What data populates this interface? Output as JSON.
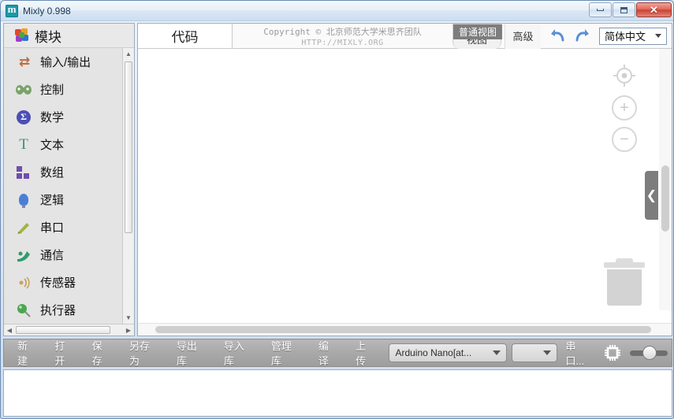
{
  "window": {
    "title": "Mixly 0.998",
    "app_icon": "mixly-app-icon",
    "controls": {
      "minimize": "minimize-icon",
      "maximize": "restore-icon",
      "close": "✕"
    }
  },
  "sidebar": {
    "header": {
      "label": "模块",
      "icon": "puzzle-icon"
    },
    "items": [
      {
        "label": "输入/输出",
        "icon": "input-output-icon",
        "glyph": "⇄"
      },
      {
        "label": "控制",
        "icon": "control-icon",
        "glyph": "🎮"
      },
      {
        "label": "数学",
        "icon": "math-icon",
        "glyph": "∑"
      },
      {
        "label": "文本",
        "icon": "text-icon",
        "glyph": "T"
      },
      {
        "label": "数组",
        "icon": "array-icon",
        "glyph": ""
      },
      {
        "label": "逻辑",
        "icon": "logic-icon",
        "glyph": ""
      },
      {
        "label": "串口",
        "icon": "serial-icon",
        "glyph": "✎"
      },
      {
        "label": "通信",
        "icon": "communication-icon",
        "glyph": "📡"
      },
      {
        "label": "传感器",
        "icon": "sensor-icon",
        "glyph": "◎"
      },
      {
        "label": "执行器",
        "icon": "actuator-icon",
        "glyph": "⬤"
      }
    ],
    "scroll": {
      "up": "▲",
      "down": "▼",
      "left": "◀",
      "right": "▶"
    }
  },
  "header": {
    "tab_code": "代码",
    "copyright_line1": "Copyright © 北京师范大学米思齐团队",
    "copyright_line2": "HTTP://MIXLY.ORG",
    "tab_view": "视图",
    "tooltip_view": "普通视图",
    "tab_advanced": "高级",
    "undo": "undo-icon",
    "redo": "redo-icon",
    "language": "简体中文"
  },
  "canvas": {
    "collapse": "❮",
    "center_control": "center-target-icon",
    "zoom_in": "+",
    "zoom_out": "−",
    "trash": "trash-icon"
  },
  "toolbar": {
    "buttons": [
      {
        "label": "新建"
      },
      {
        "label": "打开"
      },
      {
        "label": "保存"
      },
      {
        "label": "另存为"
      },
      {
        "label": "导出库"
      },
      {
        "label": "导入库"
      },
      {
        "label": "管理库"
      },
      {
        "label": "编译"
      },
      {
        "label": "上传"
      }
    ],
    "board_select": "Arduino Nano[at...",
    "port_select": "",
    "port_label": "串口...",
    "chip_icon": "microchip-icon",
    "toggle": "mode-toggle"
  },
  "colors": {
    "accent": "#1b9aa8",
    "toolbar_bg": "#a9a9a9",
    "tooltip_bg": "#7d7d7d",
    "close_btn": "#c94335"
  }
}
